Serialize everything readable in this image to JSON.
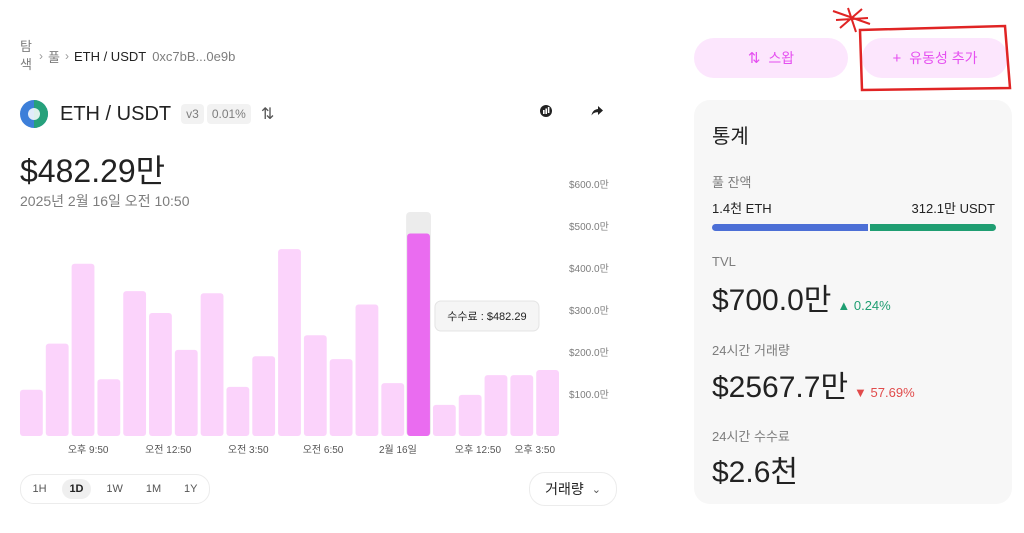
{
  "breadcrumb": {
    "explore_line1": "탐",
    "explore_line2": "색",
    "pool": "풀",
    "current": "ETH / USDT",
    "address": "0xc7bB...0e9b"
  },
  "pair": {
    "name": "ETH / USDT",
    "version": "v3",
    "fee": "0.01%",
    "swap_icon": "arrows-up-down-icon"
  },
  "header_icons": {
    "share_icon": "share-arrow-icon",
    "explorer_icon": "etherscan-icon"
  },
  "price": "$482.29만",
  "datetime": "2025년 2월 16일 오전 10:50",
  "chart_data": {
    "type": "bar",
    "metric": "수수료",
    "y_ticks": [
      "$100.0만",
      "$200.0만",
      "$300.0만",
      "$400.0만",
      "$500.0만",
      "$600.0만"
    ],
    "ylim": [
      0,
      600
    ],
    "x_tick_labels": [
      "오후 9:50",
      "오전 12:50",
      "오전 3:50",
      "오전 6:50",
      "2월 16일",
      "오후 12:50",
      "오후 3:50"
    ],
    "values": [
      110,
      220,
      410,
      135,
      345,
      293,
      205,
      340,
      117,
      190,
      445,
      240,
      183,
      313,
      126,
      482.29,
      74,
      98,
      145,
      145,
      157
    ],
    "highlight_index": 15,
    "tooltip": "수수료 : $482.29",
    "colors": {
      "bar": "#fbd3fb",
      "highlight": "#ea6cf0",
      "hover_bg": "#ececec"
    }
  },
  "timeframes": [
    {
      "label": "1H",
      "active": false
    },
    {
      "label": "1D",
      "active": true
    },
    {
      "label": "1W",
      "active": false
    },
    {
      "label": "1M",
      "active": false
    },
    {
      "label": "1Y",
      "active": false
    }
  ],
  "metric_select": {
    "value": "거래량"
  },
  "actions": {
    "swap_label": "스왑",
    "add_liquidity_label": "유동성 추가"
  },
  "stats": {
    "title": "통계",
    "balance_label": "풀 잔액",
    "eth_balance": "1.4천 ETH",
    "usdt_balance": "312.1만 USDT",
    "eth_share": 0.55,
    "tvl_label": "TVL",
    "tvl_value": "$700.0만",
    "tvl_change": "0.24%",
    "volume_label": "24시간 거래량",
    "volume_value": "$2567.7만",
    "volume_change": "57.69%",
    "fees_label": "24시간 수수료",
    "fees_value": "$2.6천"
  }
}
